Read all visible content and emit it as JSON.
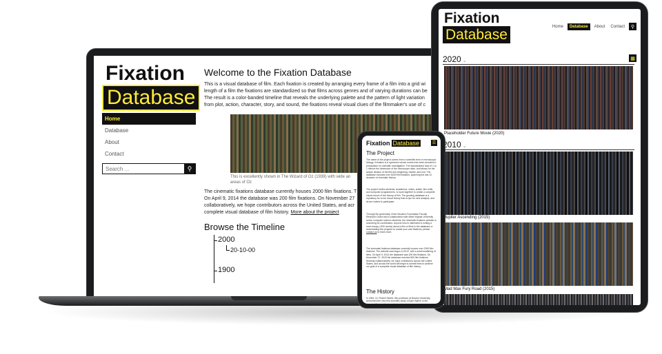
{
  "laptop": {
    "logo_top": "Fixation",
    "logo_bottom": "Database",
    "nav": [
      "Home",
      "Database",
      "About",
      "Contact"
    ],
    "search_placeholder": "Search ...",
    "title": "Welcome to the Fixation Database",
    "intro": [
      "This is a visual database of film. Each fixation is created by arranging every frame of a film into a grid wi",
      "length of a film the fixations are standardized so that films across genres and of varying durations can be",
      "The result is a color-banded timeline that reveals the underlying palette and the pattern of light variation",
      "from plot, action, character, story, and sound, the fixations reveal visual clues of the filmmaker's use of c"
    ],
    "caption_line1": "This is excellently shown in The Wizard of Oz (1939) with wide an",
    "caption_line2": "areas of Oz",
    "body": [
      "The cinematic fixations database currently houses 2000 film fixations. T",
      "On April 9, 2014 the database was 200 film fixations. On November 27",
      "collaboratively, we hope contributors across the United States, and acr",
      "complete visual database of film history."
    ],
    "more_link": "More about the project",
    "timeline_title": "Browse the Timeline",
    "timeline": {
      "year1": "2000",
      "sub": "20-10-00",
      "year2": "1900"
    }
  },
  "tablet": {
    "logo_top": "Fixation",
    "logo_bottom": "Database",
    "nav": [
      "Home",
      "Database",
      "About",
      "Contact"
    ],
    "year1": "2020",
    "year2": "2010",
    "films": [
      "Placeholder Future Movie (2020)",
      "Jupiter Ascending (2015)",
      "Mad Max Fury Road (2015)"
    ]
  },
  "phone": {
    "logo_top": "Fixation",
    "logo_bottom": "Database",
    "project_heading": "The Project",
    "project_p1": "The name of the project comes from a scientific term in microscopic biology. A fixation is a specimen whose motion has been arrested in preparation for scientific investigation. The standardized ratio of 1 to 1 mimics the dimension of the microscope slide, and allows for the simple division of the film into beginning, middle, and end. The database includes over 6200 film fixations, spanning the last 12 decades of cinematic history.",
    "project_p2": "The project invites students, academics, critics, artists, film buffs, and computer programmers, to work together to create a complete visual record of the history of film. The growing database is a repository for a rich visual history that is ripe for new analysis, and all are invited to participate.",
    "project_p3": "Through the generosity of the Mccain's Foundation Faculty Research Grant and a collaboration with West Virginia University senior computer science students, the cinematic fixations website is searching for contributors. Anyone who is interested in writing a short essay (>300 words) about a film or films in the database or downloading the program to create your own fixations, please",
    "contact_link": "contact us",
    "project_p3_end": "to learn more.",
    "project_p4": "The cinematic fixations database currently houses over 2000 film fixations. The website was begun in 2012, with a small scattering of films. On April 9, 2014 the database was 200 film fixations. On November 27, 2015 the database reached 600 film fixations. Working collaboratively, we hope contributors across the United States, and across the world will begin to submit films to achieve our goal of a complete visual database of film history.",
    "history_heading": "The History",
    "history_p1": "In 1964, Dr. Robert Steele, film professor at Boston University, performed the very first scientific study of light rhythm in the cinema. His novel approach was to make"
  }
}
